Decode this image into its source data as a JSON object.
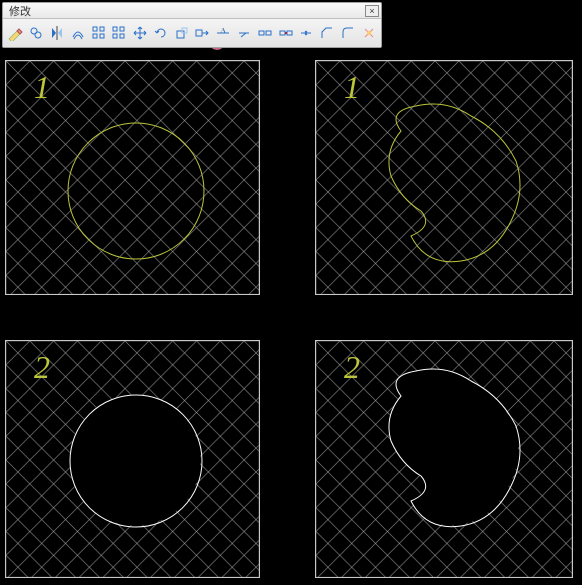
{
  "toolbar": {
    "title": "修改",
    "close_label": "×",
    "tools": [
      {
        "name": "erase",
        "icon": "pencil-erase-icon"
      },
      {
        "name": "copy",
        "icon": "copy-icon"
      },
      {
        "name": "mirror",
        "icon": "mirror-icon"
      },
      {
        "name": "offset",
        "icon": "offset-icon"
      },
      {
        "name": "array",
        "icon": "array-icon"
      },
      {
        "name": "array-rect",
        "icon": "array-rect-icon"
      },
      {
        "name": "move",
        "icon": "move-icon"
      },
      {
        "name": "rotate",
        "icon": "rotate-icon"
      },
      {
        "name": "scale",
        "icon": "scale-icon"
      },
      {
        "name": "stretch",
        "icon": "stretch-icon"
      },
      {
        "name": "trim",
        "icon": "trim-icon"
      },
      {
        "name": "extend",
        "icon": "extend-icon"
      },
      {
        "name": "break-point",
        "icon": "break-point-icon"
      },
      {
        "name": "break",
        "icon": "break-icon"
      },
      {
        "name": "join",
        "icon": "join-icon"
      },
      {
        "name": "chamfer",
        "icon": "chamfer-icon"
      },
      {
        "name": "fillet",
        "icon": "fillet-icon"
      },
      {
        "name": "explode",
        "icon": "explode-icon"
      }
    ],
    "highlighted_tool_index": 10
  },
  "panels": [
    {
      "label": "1",
      "shape": "circle",
      "shape_color": "#bcc63a",
      "hatch_trimmed": false
    },
    {
      "label": "1",
      "shape": "blob",
      "shape_color": "#bcc63a",
      "hatch_trimmed": false
    },
    {
      "label": "2",
      "shape": "circle",
      "shape_color": "#ffffff",
      "hatch_trimmed": true
    },
    {
      "label": "2",
      "shape": "blob",
      "shape_color": "#ffffff",
      "hatch_trimmed": true
    }
  ],
  "colors": {
    "accent_yellow": "#bcc63a",
    "highlight_pink": "#e47a9a",
    "grid_line": "#aaaaaa"
  }
}
